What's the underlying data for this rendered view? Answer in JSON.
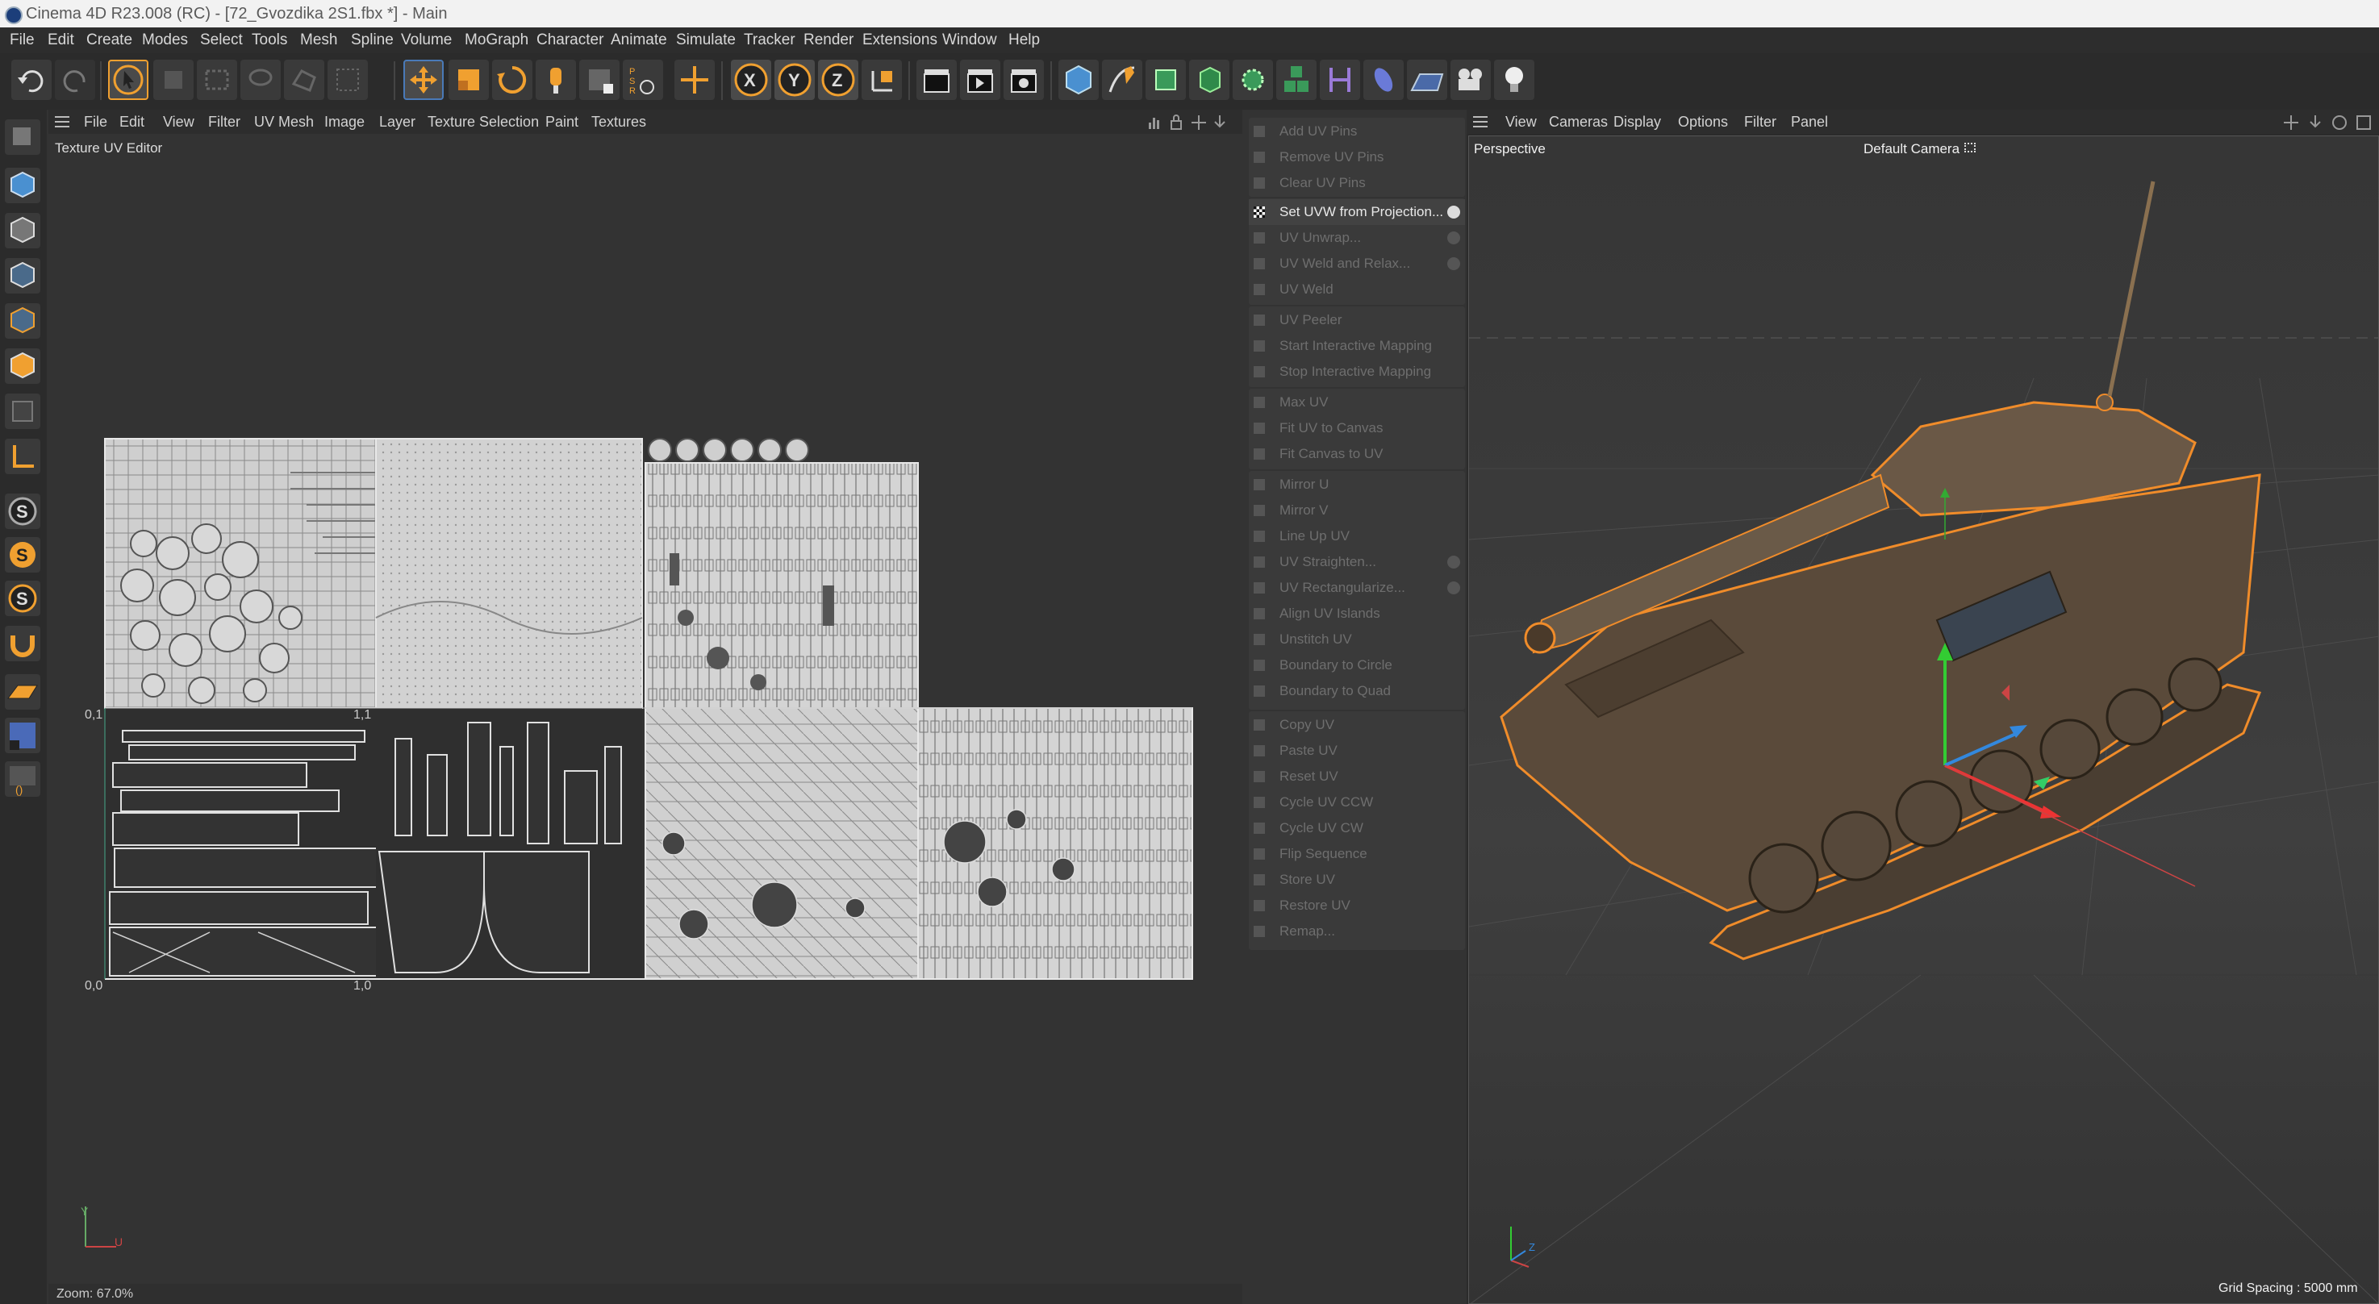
{
  "window": {
    "title": "Cinema 4D R23.008 (RC) - [72_Gvozdika 2S1.fbx *] - Main"
  },
  "menubar": [
    "File",
    "Edit",
    "Create",
    "Modes",
    "Select",
    "Tools",
    "Mesh",
    "Spline",
    "Volume",
    "MoGraph",
    "Character",
    "Animate",
    "Simulate",
    "Tracker",
    "Render",
    "Extensions",
    "Window",
    "Help"
  ],
  "uv_editor": {
    "menu": [
      "File",
      "Edit",
      "View",
      "Filter",
      "UV Mesh",
      "Image",
      "Layer",
      "Texture Selection",
      "Paint",
      "Textures"
    ],
    "title": "Texture UV Editor",
    "labels": {
      "origin": "0,0",
      "one_zero": "1,0",
      "zero_one": "0,1",
      "one_one": "1,1"
    },
    "axis": {
      "y": "Y",
      "u": "U"
    },
    "status": "Zoom: 67.0%"
  },
  "uv_commands": {
    "groups": [
      [
        "Add UV Pins",
        "Remove UV Pins",
        "Clear UV Pins"
      ],
      [
        "Set UVW from Projection...",
        "UV Unwrap...",
        "UV Weld and Relax...",
        "UV Weld"
      ],
      [
        "UV Peeler",
        "Start Interactive Mapping",
        "Stop Interactive Mapping"
      ],
      [
        "Max UV",
        "Fit UV to Canvas",
        "Fit Canvas to UV"
      ],
      [
        "Mirror U",
        "Mirror V",
        "Line Up UV",
        "UV Straighten...",
        "UV Rectangularize...",
        "Align UV Islands",
        "Unstitch UV",
        "Boundary to Circle",
        "Boundary to Quad"
      ],
      [
        "Copy UV",
        "Paste UV",
        "Reset UV",
        "Cycle UV CCW",
        "Cycle UV CW",
        "Flip Sequence",
        "Store UV",
        "Restore UV",
        "Remap..."
      ]
    ],
    "active": "Set UVW from Projection..."
  },
  "viewport": {
    "menu": [
      "View",
      "Cameras",
      "Display",
      "Options",
      "Filter",
      "Panel"
    ],
    "name": "Perspective",
    "camera": "Default Camera",
    "camera_icon": "camera-dots-icon",
    "grid_spacing": "Grid Spacing : 5000 mm",
    "axis": {
      "x": "X",
      "y": "Y",
      "z": "Z"
    }
  },
  "colors": {
    "accent": "#f0a030",
    "selection": "#f08c2a",
    "background": "#333333",
    "active_command": "#e8e8e8"
  }
}
